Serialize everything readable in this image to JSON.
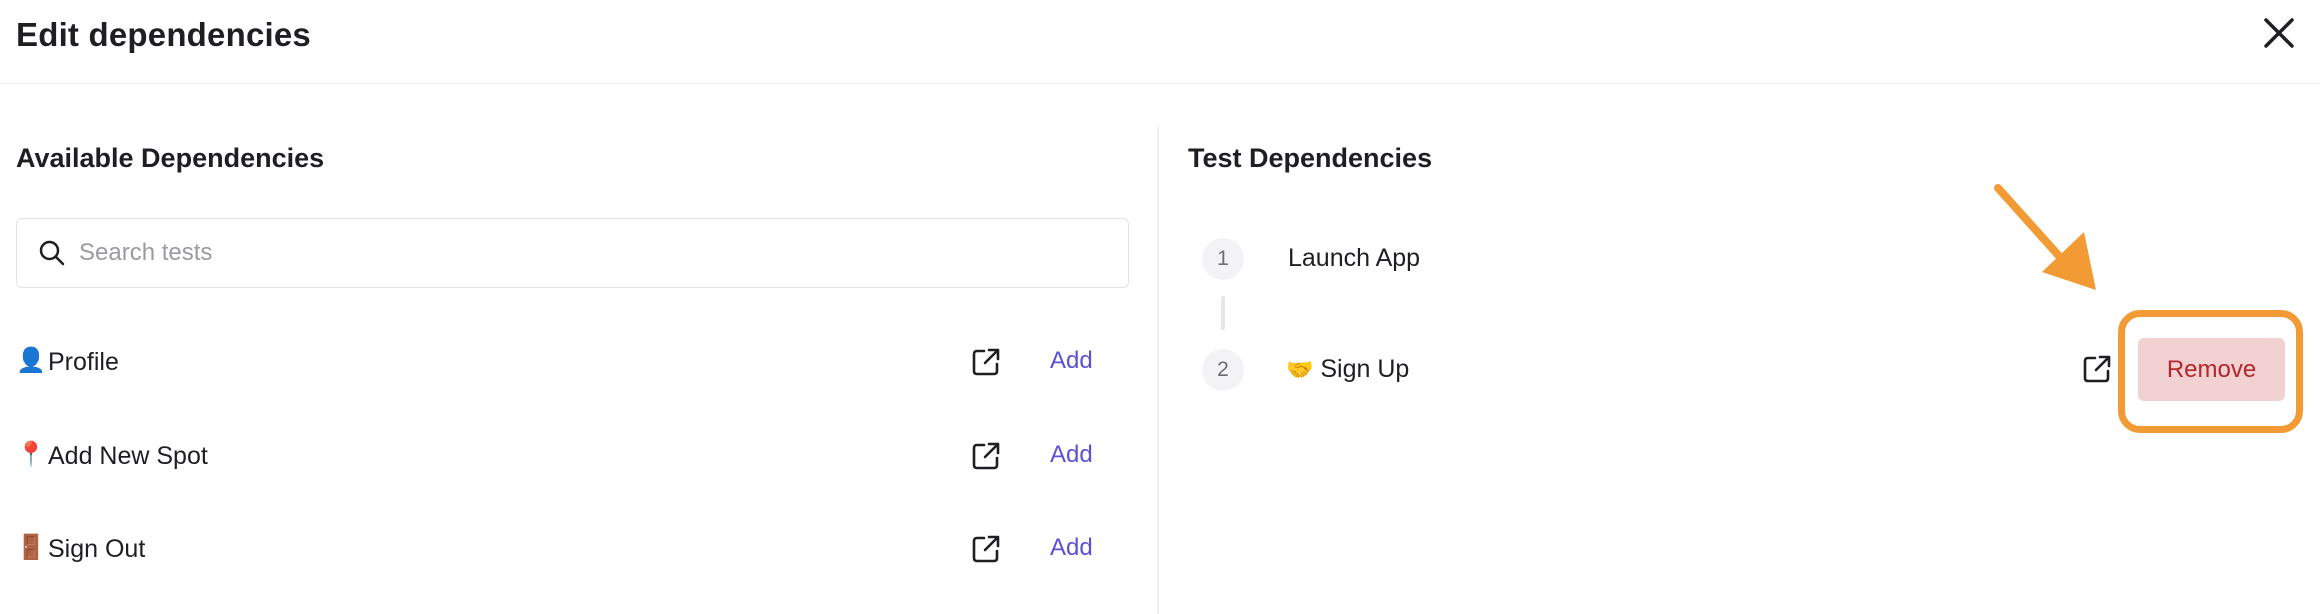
{
  "dialog": {
    "title": "Edit dependencies"
  },
  "available": {
    "title": "Available Dependencies",
    "search_placeholder": "Search tests",
    "search_value": "",
    "items": [
      {
        "emoji": "👤",
        "name": "Profile",
        "action": "Add"
      },
      {
        "emoji": "📍",
        "name": "Add New Spot",
        "action": "Add"
      },
      {
        "emoji": "🚪",
        "name": "Sign Out",
        "action": "Add"
      }
    ]
  },
  "test_dependencies": {
    "title": "Test Dependencies",
    "items": [
      {
        "index": "1",
        "emoji": "",
        "name": "Launch App"
      },
      {
        "index": "2",
        "emoji": "🤝",
        "name": "Sign Up",
        "action": "Remove"
      }
    ]
  },
  "colors": {
    "accent_link": "#5b50d6",
    "remove_bg": "#f2d1d2",
    "remove_text": "#b3262b",
    "annotation": "#f29a33"
  },
  "icons": [
    "close-icon",
    "search-icon",
    "external-link-icon",
    "annotation-arrow"
  ]
}
